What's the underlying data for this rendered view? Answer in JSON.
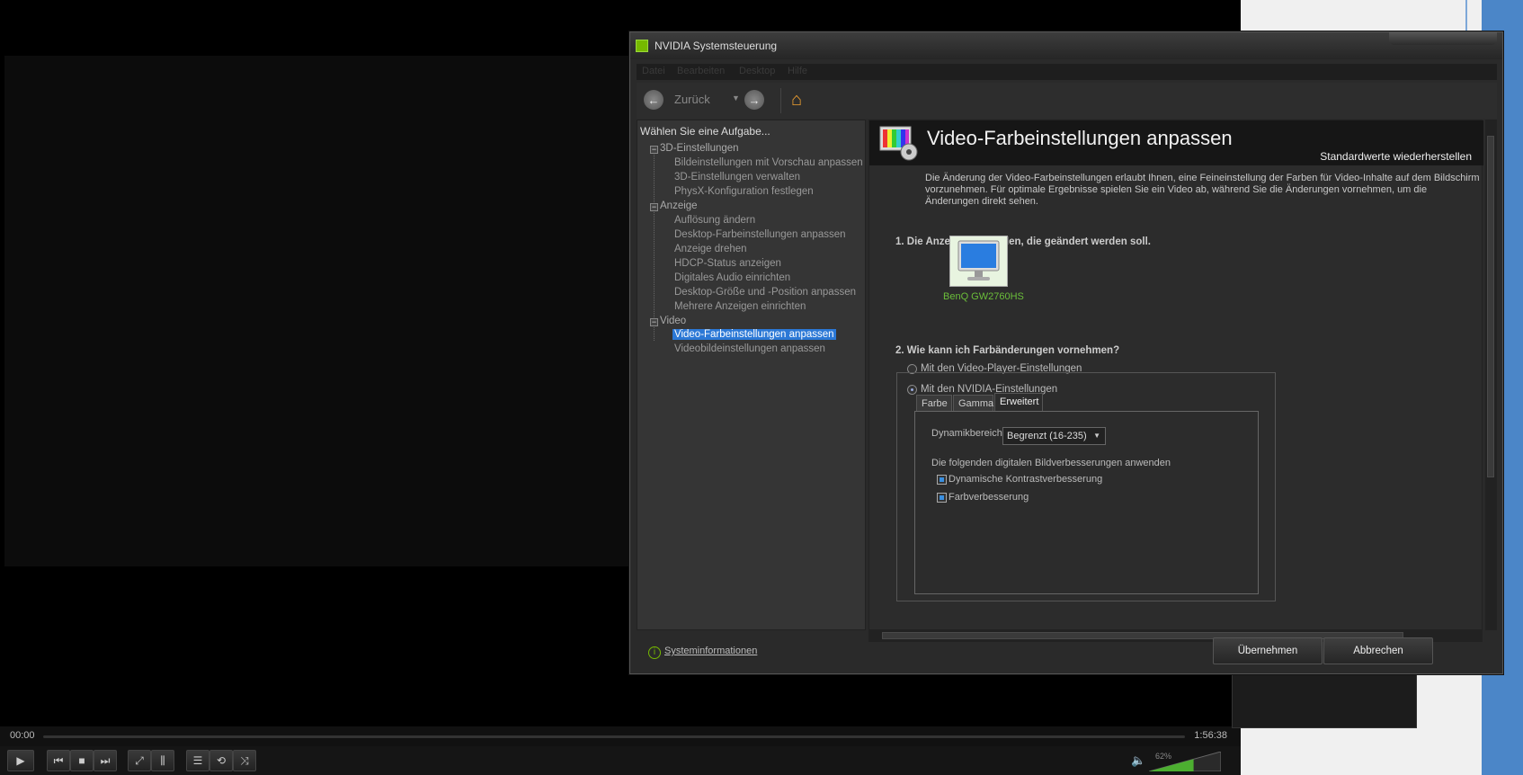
{
  "player": {
    "time_current": "00:00",
    "time_total": "1:56:38",
    "volume": "62%",
    "volume_level": 0.62
  },
  "window": {
    "title": "NVIDIA Systemsteuerung"
  },
  "menu": [
    "Datei",
    "Bearbeiten",
    "Desktop",
    "Hilfe"
  ],
  "toolbar": {
    "back_label": "Zurück"
  },
  "tasks": {
    "header": "Wählen Sie eine Aufgabe...",
    "groups": [
      {
        "label": "3D-Einstellungen",
        "items": [
          "Bildeinstellungen mit Vorschau anpassen",
          "3D-Einstellungen verwalten",
          "PhysX-Konfiguration festlegen"
        ]
      },
      {
        "label": "Anzeige",
        "items": [
          "Auflösung ändern",
          "Desktop-Farbeinstellungen anpassen",
          "Anzeige drehen",
          "HDCP-Status anzeigen",
          "Digitales Audio einrichten",
          "Desktop-Größe und -Position anpassen",
          "Mehrere Anzeigen einrichten"
        ]
      },
      {
        "label": "Video",
        "items": [
          "Video-Farbeinstellungen anpassen",
          "Videobildeinstellungen anpassen"
        ]
      }
    ]
  },
  "content": {
    "title": "Video-Farbeinstellungen anpassen",
    "restore": "Standardwerte wiederherstellen",
    "description": "Die Änderung der Video-Farbeinstellungen erlaubt Ihnen, eine Feineinstellung der Farben für Video-Inhalte auf dem Bildschirm vorzunehmen. Für optimale Ergebnisse spielen Sie ein Video ab, während Sie die Änderungen vornehmen, um die Änderungen direkt sehen.",
    "section1": "1. Die Anzeige auswählen, die geändert werden soll.",
    "display_name": "BenQ GW2760HS",
    "section2": "2. Wie kann ich Farbänderungen vornehmen?",
    "radio_player": "Mit den Video-Player-Einstellungen",
    "radio_nvidia": "Mit den NVIDIA-Einstellungen",
    "tabs": [
      "Farbe",
      "Gamma",
      "Erweitert"
    ],
    "dyn_label": "Dynamikbereich:",
    "dyn_value": "Begrenzt (16-235)",
    "enh_label": "Die folgenden digitalen Bildverbesserungen anwenden",
    "chk_contrast": "Dynamische Kontrastverbesserung",
    "chk_color": "Farbverbesserung"
  },
  "footer": {
    "sysinfo": "Systeminformationen",
    "apply": "Übernehmen",
    "cancel": "Abbrechen"
  },
  "colors": {
    "nvidia_green": "#76b900",
    "selection_blue": "#2b78d6",
    "display_label": "#6bbe3a"
  }
}
